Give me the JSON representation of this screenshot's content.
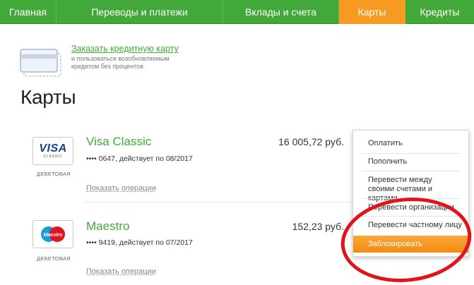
{
  "nav": {
    "items": [
      {
        "label": "Главная"
      },
      {
        "label": "Переводы и платежи"
      },
      {
        "label": "Вклады и счета"
      },
      {
        "label": "Карты"
      },
      {
        "label": "Кредиты"
      }
    ],
    "active_index": 3
  },
  "promo": {
    "link": "Заказать кредитную карту",
    "description": "и пользоваться возобновляемым кредитом без процентов"
  },
  "page_title": "Карты",
  "cards": [
    {
      "logo": "VISA",
      "logo_sub": "CLASSIC",
      "type": "ДЕБЕТОВАЯ",
      "name": "Visa Classic",
      "number": "•••• 0647, действует по 08/2017",
      "amount": "16 005,72 руб.",
      "ops": "Показать операции"
    },
    {
      "logo": "Maestro",
      "type": "ДЕБЕТОВАЯ",
      "name": "Maestro",
      "number": "•••• 9419, действует по 07/2017",
      "amount": "152,23 руб.",
      "ops": "Показать операции"
    }
  ],
  "menu": {
    "items": [
      "Оплатить",
      "Пополнить",
      "Перевести между своими счетами и картами",
      "Перевести организации",
      "Перевести частному лицу",
      "Заблокировать"
    ]
  },
  "colors": {
    "brand_green": "#43a83a",
    "accent_orange": "#f79a21",
    "annotation_red": "#e0151b"
  }
}
